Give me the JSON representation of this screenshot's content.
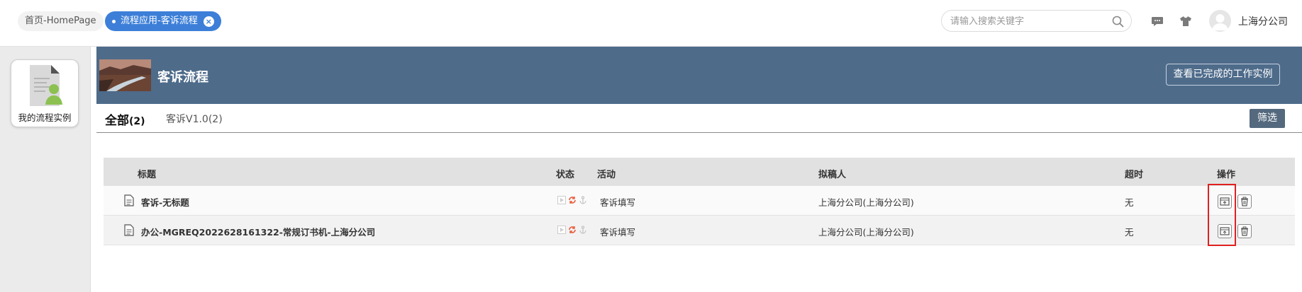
{
  "header": {
    "tabs": [
      {
        "label": "首页-HomePage"
      },
      {
        "label": "流程应用-客诉流程"
      }
    ],
    "search": {
      "placeholder": "请输入搜索关键字",
      "value": ""
    },
    "user_name": "上海分公司"
  },
  "sidebar": {
    "items": [
      {
        "label": "我的流程实例",
        "icon": "user-document-icon"
      }
    ]
  },
  "banner": {
    "title": "客诉流程",
    "completed_button": "查看已完成的工作实例"
  },
  "filters": {
    "all_label": "全部",
    "all_count": "(2)",
    "version_tab": "客诉V1.0(2)",
    "filter_button": "筛选"
  },
  "table": {
    "columns": {
      "title": "标题",
      "status": "状态",
      "activity": "活动",
      "drafter": "拟稿人",
      "timeout": "超时",
      "actions": "操作"
    },
    "rows": [
      {
        "title": "客诉-无标题",
        "activity": "客诉填写",
        "drafter": "上海分公司(上海分公司)",
        "timeout": "无"
      },
      {
        "title": "办公-MGREQ2022628161322-常规订书机-上海分公司",
        "activity": "客诉填写",
        "drafter": "上海分公司(上海分公司)",
        "timeout": "无"
      }
    ]
  },
  "colors": {
    "accent": "#3d7fd8",
    "banner": "#4e6b8a",
    "filter_button": "#54697e",
    "highlight": "#e02020"
  }
}
